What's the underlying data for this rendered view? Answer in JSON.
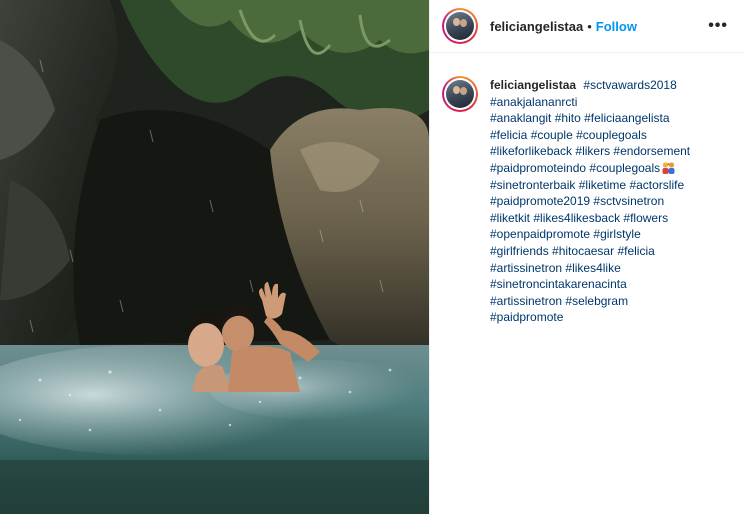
{
  "post": {
    "photo": {
      "alt_icon": "photo-couple-waterfall"
    },
    "header": {
      "username": "feliciangelistaa",
      "separator": "•",
      "follow_label": "Follow",
      "more_label": "•••"
    },
    "caption": {
      "username": "feliciangelistaa",
      "hashtags": [
        "#sctvawards2018",
        "#anakjalananrcti",
        "#anaklangit",
        "#hito",
        "#feliciaangelista",
        "#felicia",
        "#couple",
        "#couplegoals",
        "#likeforlikeback",
        "#likers",
        "#endorsement",
        "#paidpromoteindo",
        "#couplegoals",
        "#sinetronterbaik",
        "#liketime",
        "#actorslife",
        "#paidpromote2019",
        "#sctvsinetron",
        "#liketkit",
        "#likes4likesback",
        "#flowers",
        "#openpaidpromote",
        "#girlstyle",
        "#girlfriends",
        "#hitocaesar",
        "#felicia",
        "#artissinetron",
        "#likes4like",
        "#sinetroncintakarenacinta",
        "#artissinetron",
        "#selebgram",
        "#paidpromote"
      ],
      "emoji_icon": "couple-emoji-icon"
    },
    "colors": {
      "link": "#0095f6",
      "hashtag": "#00376b",
      "text": "#262626"
    }
  }
}
